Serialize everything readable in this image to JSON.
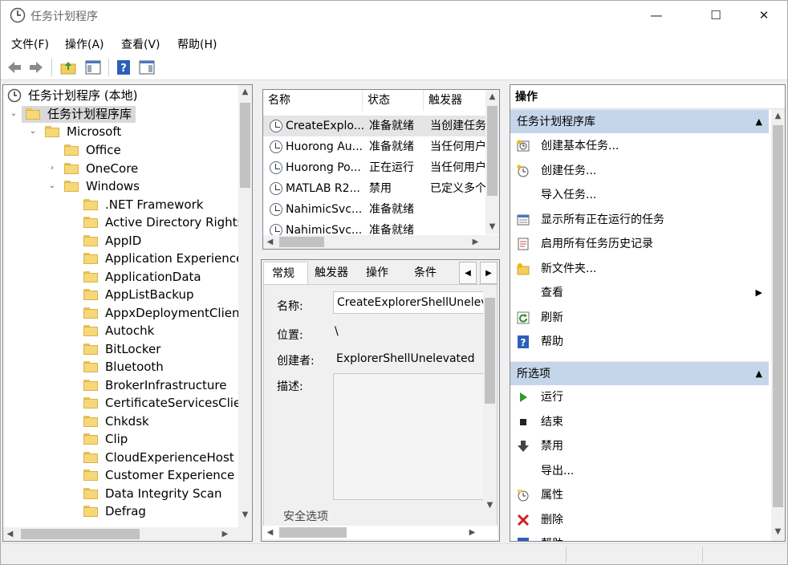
{
  "window": {
    "title": "任务计划程序",
    "minimize": "—",
    "maximize": "☐",
    "close": "✕"
  },
  "menu": [
    "文件(F)",
    "操作(A)",
    "查看(V)",
    "帮助(H)"
  ],
  "toolbar": {
    "back": "back-arrow-icon",
    "forward": "forward-arrow-icon",
    "up": "folder-up-icon",
    "show_hide": "show-hide-console-tree-icon",
    "help": "help-icon",
    "action_pane": "show-action-pane-icon"
  },
  "tree": {
    "root": "任务计划程序 (本地)",
    "library": "任务计划程序库",
    "microsoft": "Microsoft",
    "children": [
      {
        "label": "Office",
        "expander": ""
      },
      {
        "label": "OneCore",
        "expander": "›"
      },
      {
        "label": "Windows",
        "expander": "⌄"
      }
    ],
    "windows_children": [
      ".NET Framework",
      "Active Directory Rights M",
      "AppID",
      "Application Experience",
      "ApplicationData",
      "AppListBackup",
      "AppxDeploymentClient",
      "Autochk",
      "BitLocker",
      "Bluetooth",
      "BrokerInfrastructure",
      "CertificateServicesClient",
      "Chkdsk",
      "Clip",
      "CloudExperienceHost",
      "Customer Experience Im",
      "Data Integrity Scan",
      "Defrag"
    ]
  },
  "tasks": {
    "columns": [
      "名称",
      "状态",
      "触发器"
    ],
    "rows": [
      {
        "name": "CreateExplo...",
        "status": "准备就绪",
        "trigger": "当创建任务"
      },
      {
        "name": "Huorong Au...",
        "status": "准备就绪",
        "trigger": "当任何用户"
      },
      {
        "name": "Huorong Po...",
        "status": "正在运行",
        "trigger": "当任何用户"
      },
      {
        "name": "MATLAB R2...",
        "status": "禁用",
        "trigger": "已定义多个"
      },
      {
        "name": "NahimicSvc...",
        "status": "准备就绪",
        "trigger": ""
      },
      {
        "name": "NahimicSvc...",
        "status": "准备就绪",
        "trigger": ""
      }
    ]
  },
  "details": {
    "tabs": [
      "常规",
      "触发器",
      "操作",
      "条件"
    ],
    "name_label": "名称:",
    "name_value": "CreateExplorerShellUnelevatedTask",
    "location_label": "位置:",
    "location_value": "\\",
    "author_label": "创建者:",
    "author_value": "ExplorerShellUnelevated",
    "desc_label": "描述:",
    "desc_value": "",
    "security_label": "安全选项"
  },
  "actions": {
    "title": "操作",
    "section1": "任务计划程序库",
    "items1": [
      {
        "label": "创建基本任务...",
        "icon": "create-basic-task-icon"
      },
      {
        "label": "创建任务...",
        "icon": "create-task-icon"
      },
      {
        "label": "导入任务...",
        "icon": ""
      },
      {
        "label": "显示所有正在运行的任务",
        "icon": "running-tasks-icon"
      },
      {
        "label": "启用所有任务历史记录",
        "icon": "history-icon"
      },
      {
        "label": "新文件夹...",
        "icon": "new-folder-icon"
      },
      {
        "label": "查看",
        "icon": ""
      },
      {
        "label": "刷新",
        "icon": "refresh-icon"
      },
      {
        "label": "帮助",
        "icon": "help-icon"
      }
    ],
    "section2": "所选项",
    "items2": [
      {
        "label": "运行",
        "icon": "run-icon"
      },
      {
        "label": "结束",
        "icon": "end-icon"
      },
      {
        "label": "禁用",
        "icon": "disable-icon"
      },
      {
        "label": "导出...",
        "icon": ""
      },
      {
        "label": "属性",
        "icon": "properties-icon"
      },
      {
        "label": "删除",
        "icon": "delete-icon"
      },
      {
        "label": "帮助",
        "icon": "help-icon"
      }
    ]
  }
}
